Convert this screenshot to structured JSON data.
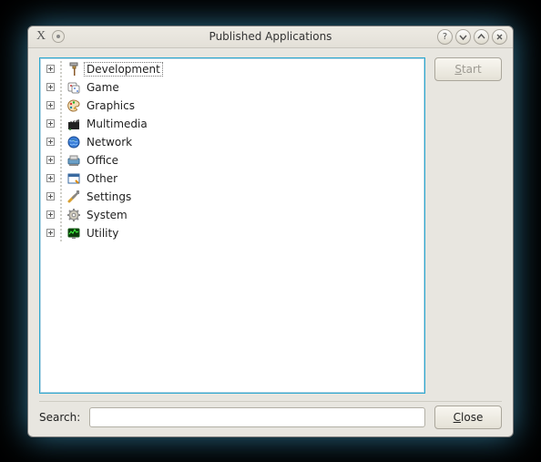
{
  "window": {
    "title": "Published Applications"
  },
  "buttons": {
    "start": "Start",
    "close": "Close"
  },
  "search": {
    "label": "Search:",
    "value": ""
  },
  "tree": {
    "items": [
      {
        "id": "development",
        "label": "Development",
        "icon": "hammer-icon",
        "selected": true
      },
      {
        "id": "game",
        "label": "Game",
        "icon": "dice-icon"
      },
      {
        "id": "graphics",
        "label": "Graphics",
        "icon": "palette-icon"
      },
      {
        "id": "multimedia",
        "label": "Multimedia",
        "icon": "clapper-icon"
      },
      {
        "id": "network",
        "label": "Network",
        "icon": "globe-icon"
      },
      {
        "id": "office",
        "label": "Office",
        "icon": "typewriter-icon"
      },
      {
        "id": "other",
        "label": "Other",
        "icon": "window-icon"
      },
      {
        "id": "settings",
        "label": "Settings",
        "icon": "tools-icon"
      },
      {
        "id": "system",
        "label": "System",
        "icon": "gear-icon"
      },
      {
        "id": "utility",
        "label": "Utility",
        "icon": "monitor-icon"
      }
    ]
  }
}
